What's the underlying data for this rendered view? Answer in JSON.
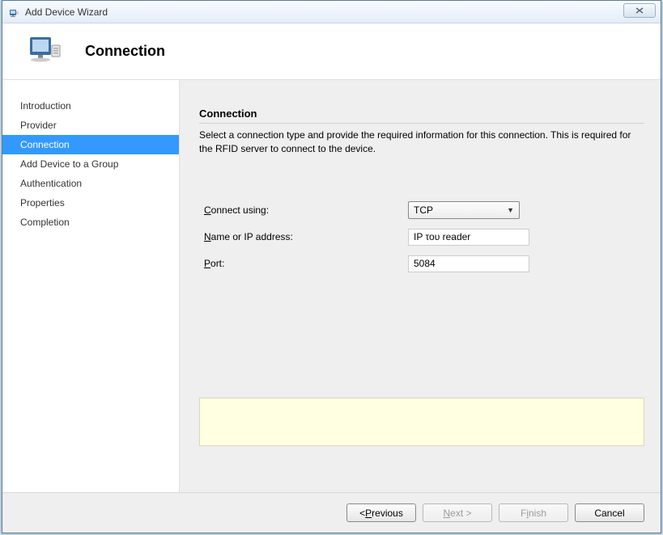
{
  "window": {
    "title": "Add Device Wizard",
    "close": "✕"
  },
  "header": {
    "title": "Connection"
  },
  "sidebar": {
    "items": [
      {
        "label": "Introduction",
        "selected": false
      },
      {
        "label": "Provider",
        "selected": false
      },
      {
        "label": "Connection",
        "selected": true
      },
      {
        "label": "Add Device to a Group",
        "selected": false
      },
      {
        "label": "Authentication",
        "selected": false
      },
      {
        "label": "Properties",
        "selected": false
      },
      {
        "label": "Completion",
        "selected": false
      }
    ]
  },
  "content": {
    "title": "Connection",
    "description": "Select a connection type and provide the required information for this connection. This is required for the RFID server to connect to the device.",
    "fields": {
      "connect_using": {
        "label_pre": "C",
        "label_post": "onnect using:",
        "value": "TCP"
      },
      "name_or_ip": {
        "label_pre": "N",
        "label_post": "ame or IP address:",
        "value": "IP του reader"
      },
      "port": {
        "label_pre": "P",
        "label_post": "ort:",
        "value": "5084"
      }
    }
  },
  "footer": {
    "previous_pre": "< ",
    "previous_mn": "P",
    "previous_post": "revious",
    "next_pre": "",
    "next_mn": "N",
    "next_post": "ext >",
    "finish_pre": "F",
    "finish_mn": "i",
    "finish_post": "nish",
    "cancel": "Cancel"
  }
}
